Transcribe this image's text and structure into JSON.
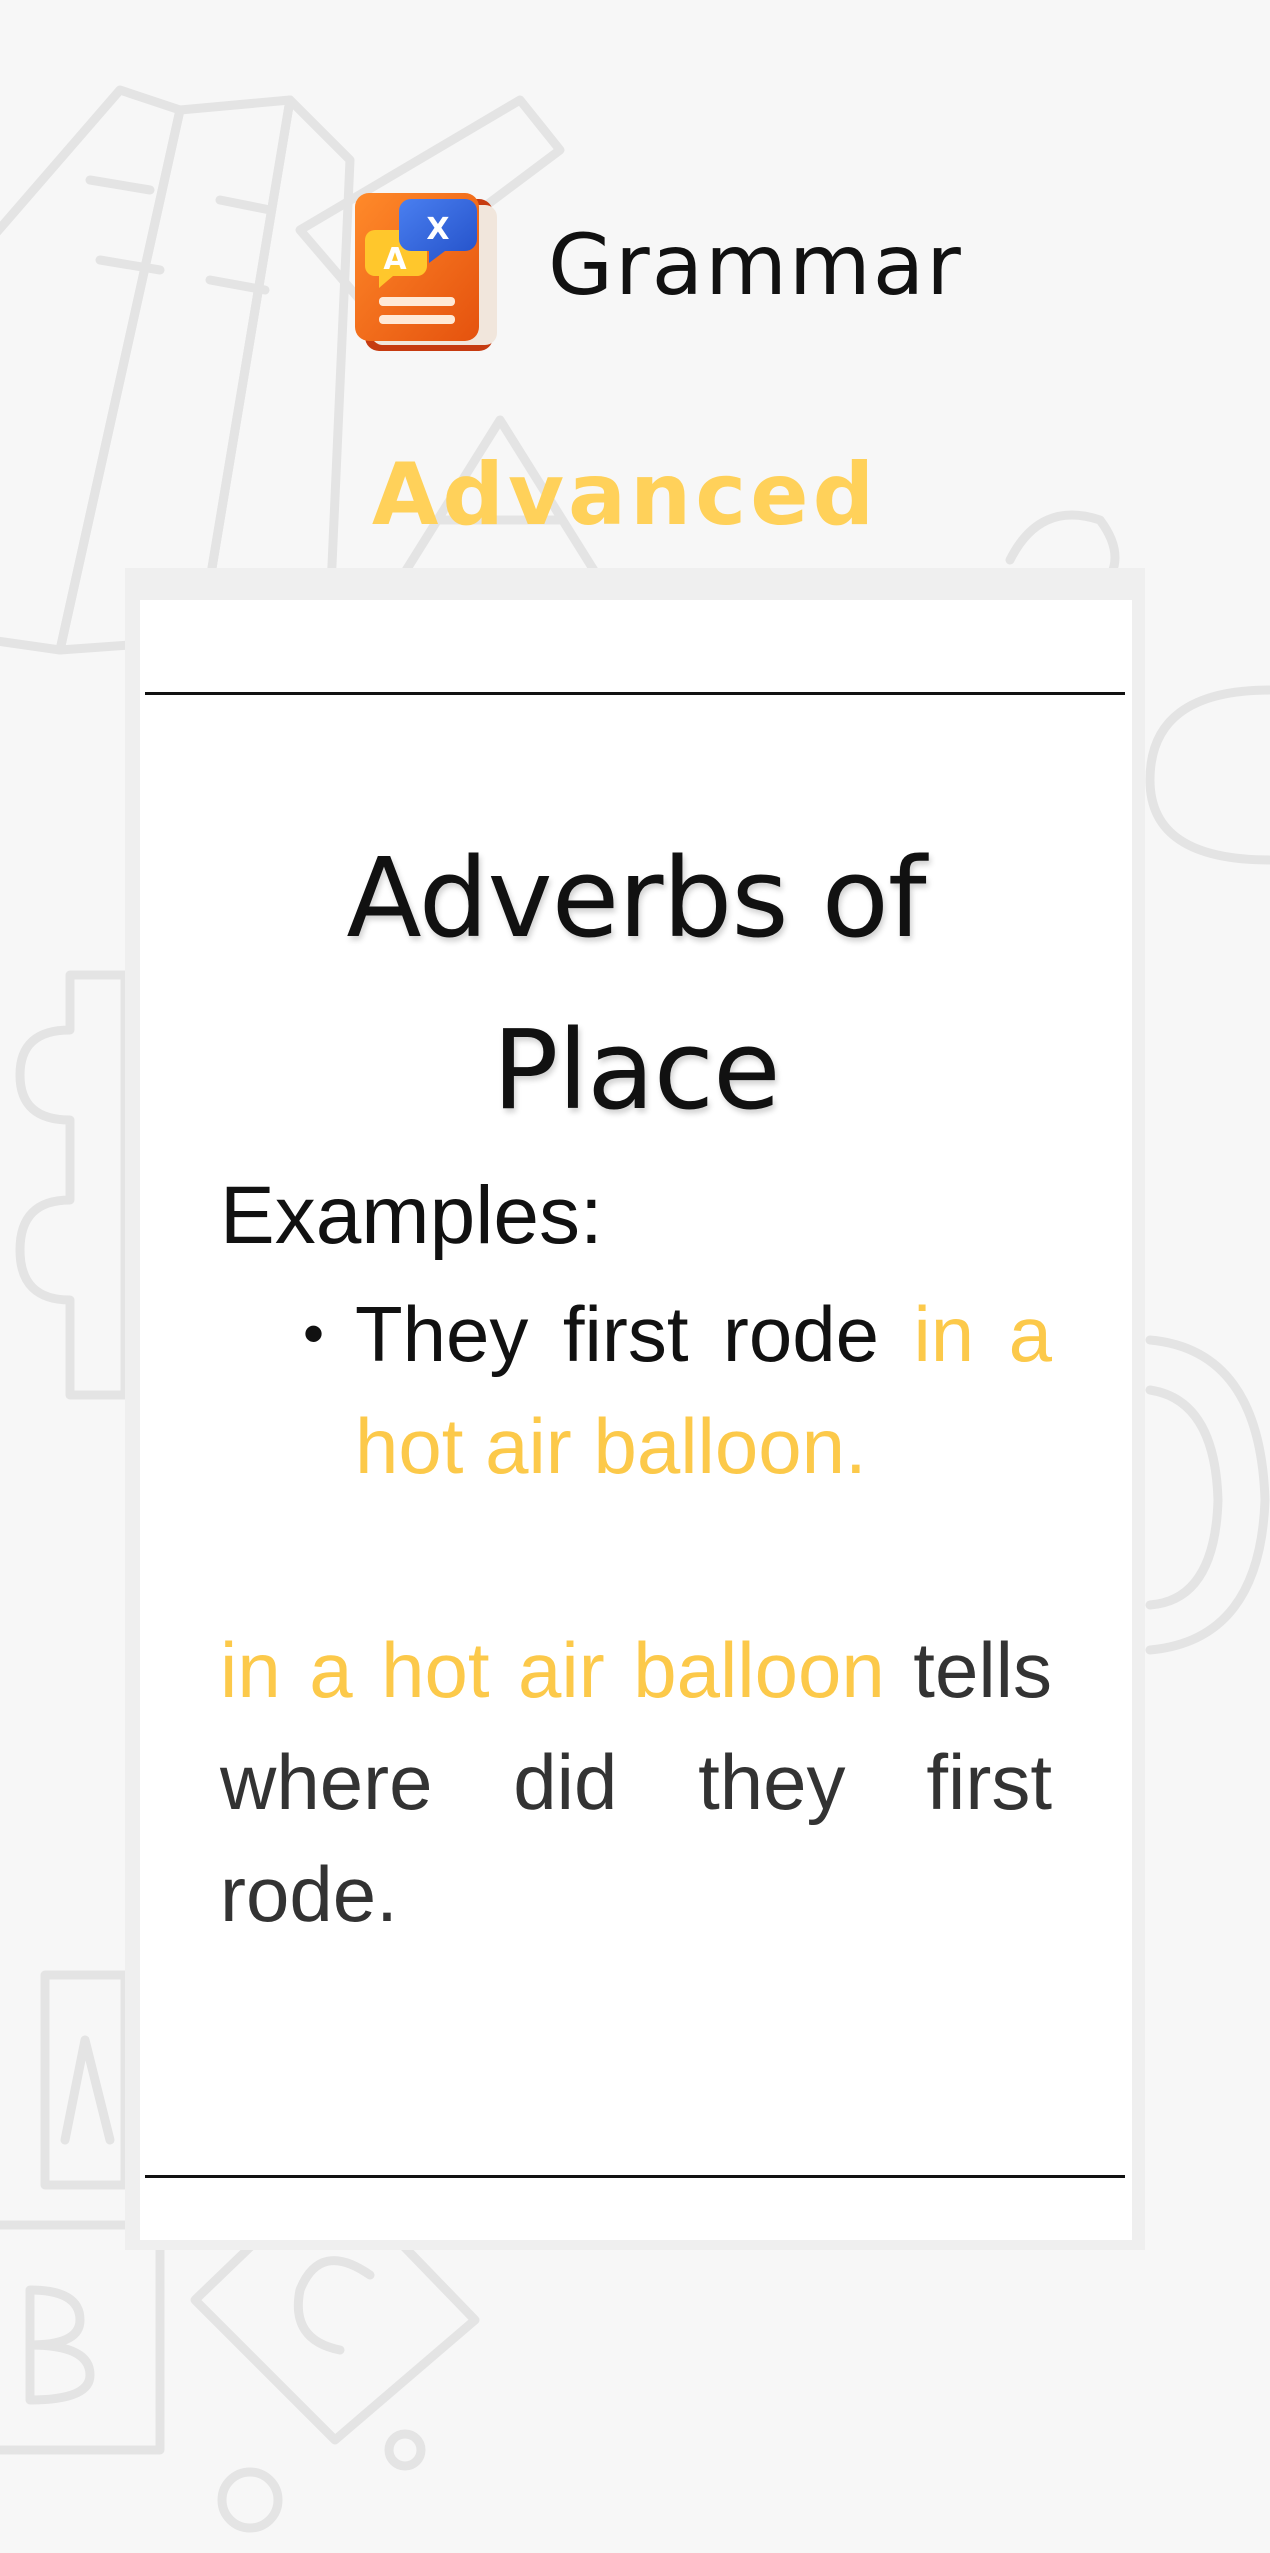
{
  "app": {
    "title": "Grammar",
    "level": "Advanced",
    "logo_icon": "grammar-book-icon",
    "logo_letters": [
      "A",
      "X"
    ]
  },
  "lesson": {
    "heading": "Adverbs of Place",
    "examples_label": "Examples:",
    "examples": [
      {
        "plain": "They first rode ",
        "highlight": "in a hot air balloon."
      }
    ],
    "explanation": {
      "highlight": "in a hot air balloon",
      "plain": " tells where did they first rode."
    }
  },
  "colors": {
    "accent": "#fcc94a",
    "level": "#ffd15a",
    "text": "#111111",
    "background": "#f7f7f7",
    "card": "#ffffff",
    "logo_book": "#f26a1b",
    "logo_bubble": "#2f63e0"
  }
}
